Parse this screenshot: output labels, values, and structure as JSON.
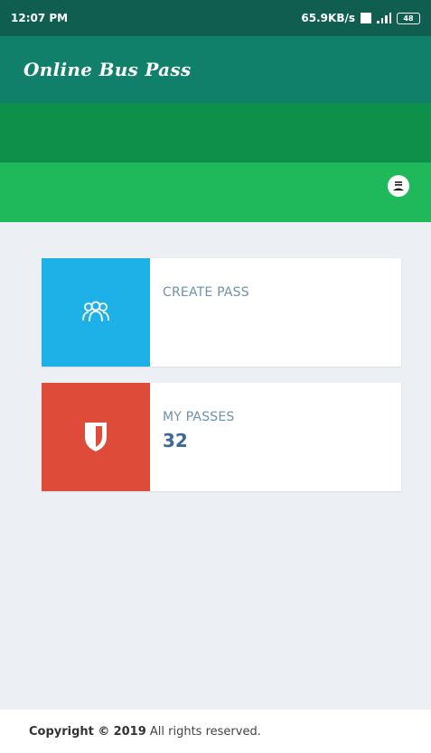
{
  "status_bar": {
    "time": "12:07 PM",
    "network_speed": "65.9KB/s",
    "battery": "48"
  },
  "app_bar": {
    "title": "Online Bus Pass"
  },
  "profile": {
    "icon": "account-icon"
  },
  "cards": [
    {
      "label": "CREATE PASS",
      "icon": "group-users-icon",
      "color": "#1db1e8"
    },
    {
      "label": "MY PASSES",
      "count": "32",
      "icon": "shield-icon",
      "color": "#de4b38"
    }
  ],
  "footer": {
    "copyright_prefix": "Copyright ©",
    "year": "2019",
    "rights": "All rights reserved."
  },
  "colors": {
    "status_bar": "#0f5e4f",
    "app_bar": "#11806b",
    "band_dark": "#0e8f4a",
    "band_light": "#1fb85a",
    "content_bg": "#eceff4"
  }
}
